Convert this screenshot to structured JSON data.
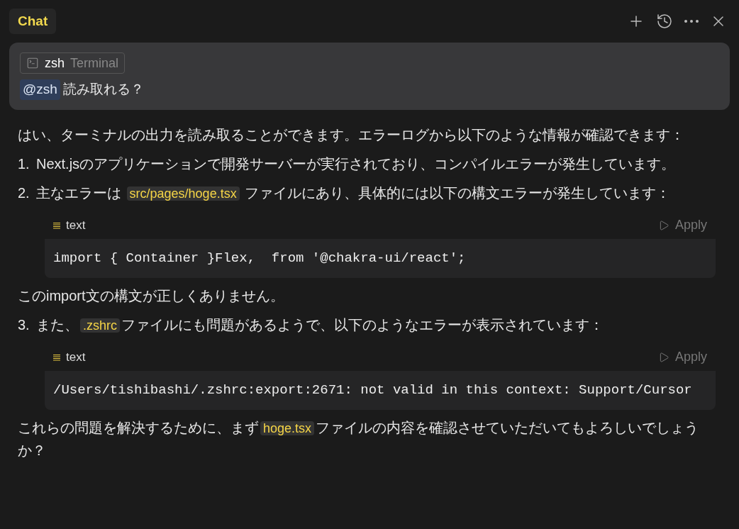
{
  "tab": {
    "label": "Chat",
    "selected": true
  },
  "user_message": {
    "context_chip": {
      "name": "zsh",
      "type": "Terminal"
    },
    "mention": "@zsh",
    "text": "読み取れる？"
  },
  "response": [
    {
      "kind": "paragraph",
      "segments": [
        {
          "kind": "text",
          "text": "はい、ターミナルの出力を読み取ることができます。エラーログから以下のような情報が確認できます："
        }
      ]
    },
    {
      "kind": "list_item",
      "number": "1.",
      "segments": [
        {
          "kind": "text",
          "text": "Next.jsのアプリケーションで開発サーバーが実行されており、コンパイルエラーが発生しています。"
        }
      ]
    },
    {
      "kind": "list_item",
      "number": "2.",
      "segments": [
        {
          "kind": "text",
          "text": "主なエラーは "
        },
        {
          "kind": "code",
          "text": "src/pages/hoge.tsx"
        },
        {
          "kind": "text",
          "text": " ファイルにあり、具体的には以下の構文エラーが発生しています："
        }
      ]
    },
    {
      "kind": "code_block",
      "language": "text",
      "action": "Apply",
      "code": "import { Container }Flex,  from '@chakra-ui/react';"
    },
    {
      "kind": "paragraph",
      "segments": [
        {
          "kind": "text",
          "text": "このimport文の構文が正しくありません。"
        }
      ]
    },
    {
      "kind": "list_item",
      "number": "3.",
      "segments": [
        {
          "kind": "text",
          "text": "また、"
        },
        {
          "kind": "code",
          "text": ".zshrc"
        },
        {
          "kind": "text",
          "text": "ファイルにも問題があるようで、以下のようなエラーが表示されています："
        }
      ]
    },
    {
      "kind": "code_block",
      "language": "text",
      "action": "Apply",
      "code": "/Users/tishibashi/.zshrc:export:2671: not valid in this context: Support/Cursor"
    },
    {
      "kind": "paragraph",
      "segments": [
        {
          "kind": "text",
          "text": "これらの問題を解決するために、まず"
        },
        {
          "kind": "code",
          "text": "hoge.tsx"
        },
        {
          "kind": "text",
          "text": "ファイルの内容を確認させていただいてもよろしいでしょうか？"
        }
      ]
    }
  ]
}
